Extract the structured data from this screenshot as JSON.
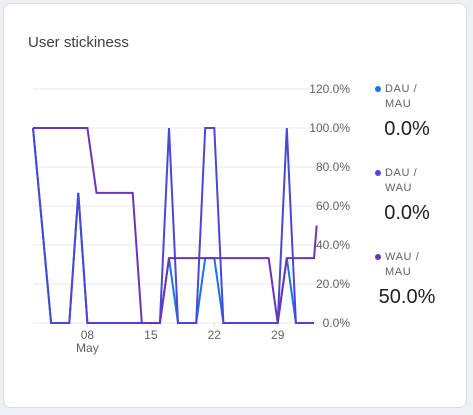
{
  "card": {
    "title": "User stickiness"
  },
  "colors": {
    "dau_mau": "#1a73e8",
    "dau_wau": "#4b47d6",
    "wau_mau": "#6a35b8",
    "grid": "#e8eaed"
  },
  "legend": [
    {
      "label_line1": "DAU /",
      "label_line2": "MAU",
      "value": "0.0%"
    },
    {
      "label_line1": "DAU /",
      "label_line2": "WAU",
      "value": "0.0%"
    },
    {
      "label_line1": "WAU /",
      "label_line2": "MAU",
      "value": "50.0%"
    }
  ],
  "chart_data": {
    "type": "line",
    "x": [
      2,
      3,
      4,
      5,
      6,
      7,
      8,
      9,
      10,
      11,
      12,
      13,
      14,
      15,
      16,
      17,
      18,
      19,
      20,
      21,
      22,
      23,
      24,
      25,
      26,
      27,
      28,
      29,
      30,
      31,
      32,
      33
    ],
    "x_ticks": [
      {
        "x": 8,
        "label": "08",
        "sublabel": "May"
      },
      {
        "x": 15,
        "label": "15",
        "sublabel": ""
      },
      {
        "x": 22,
        "label": "22",
        "sublabel": ""
      },
      {
        "x": 29,
        "label": "29",
        "sublabel": ""
      }
    ],
    "y_ticks": [
      "0.0%",
      "20.0%",
      "40.0%",
      "60.0%",
      "80.0%",
      "100.0%",
      "120.0%"
    ],
    "ylim": [
      0,
      120
    ],
    "series": [
      {
        "name": "DAU / MAU",
        "color": "#1a73e8",
        "values": [
          100,
          50,
          0,
          0,
          0,
          66.7,
          0,
          0,
          0,
          0,
          0,
          0,
          0,
          0,
          0,
          33.3,
          0,
          0,
          0,
          33.3,
          33.3,
          0,
          0,
          0,
          0,
          0,
          0,
          0,
          33.3,
          0,
          0,
          0
        ]
      },
      {
        "name": "DAU / WAU",
        "color": "#4b47d6",
        "values": [
          100,
          50,
          0,
          0,
          0,
          66.7,
          0,
          0,
          0,
          0,
          0,
          0,
          0,
          0,
          0,
          100,
          0,
          0,
          0,
          100,
          100,
          0,
          0,
          0,
          0,
          0,
          0,
          0,
          100,
          0,
          0,
          0
        ]
      },
      {
        "name": "WAU / MAU",
        "color": "#6a35b8",
        "values": [
          100,
          100,
          100,
          100,
          100,
          100,
          100,
          66.7,
          66.7,
          66.7,
          66.7,
          66.7,
          0,
          0,
          0,
          33.3,
          33.3,
          33.3,
          33.3,
          33.3,
          33.3,
          33.3,
          33.3,
          33.3,
          33.3,
          33.3,
          33.3,
          0,
          33.3,
          33.3,
          33.3,
          33.3
        ]
      }
    ],
    "last_point_overrides": {
      "WAU / MAU": 50
    }
  }
}
